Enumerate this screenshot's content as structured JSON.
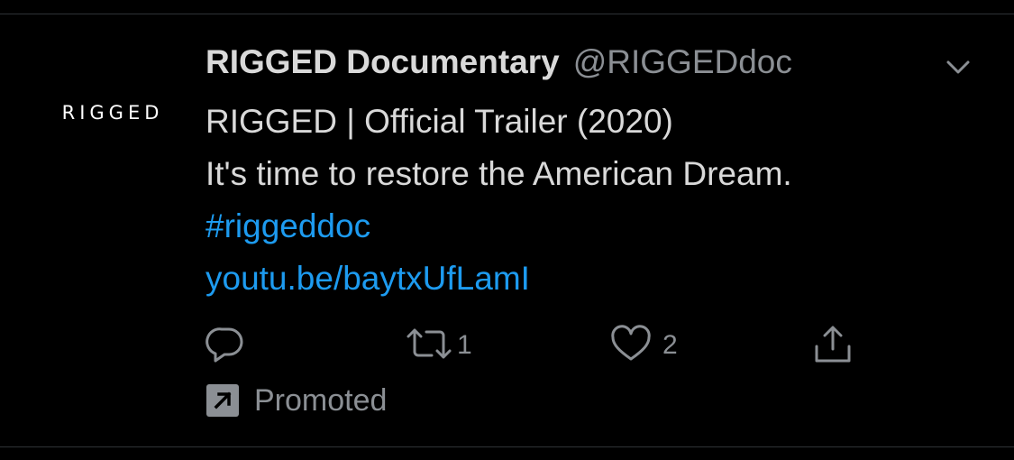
{
  "tweet": {
    "avatar_text": "RIGGED",
    "display_name": "RIGGED Documentary",
    "handle": "@RIGGEDdoc",
    "lines": {
      "title": "RIGGED | Official Trailer (2020)",
      "tagline": "It's time to restore the American Dream.",
      "hashtag": "#riggeddoc",
      "link": "youtu.be/baytxUfLamI"
    }
  },
  "actions": {
    "reply_icon": "reply-icon",
    "retweet_icon": "retweet-icon",
    "retweet_count": "1",
    "like_icon": "heart-icon",
    "like_count": "2",
    "share_icon": "share-icon"
  },
  "promoted": {
    "label": "Promoted",
    "icon": "promoted-arrow-icon"
  },
  "colors": {
    "background": "#000000",
    "text": "#d9d9d9",
    "muted": "#8b8f94",
    "link": "#1d9bf0"
  }
}
